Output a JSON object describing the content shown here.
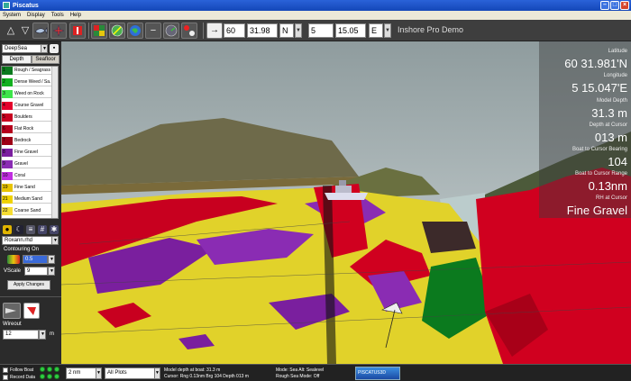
{
  "window": {
    "title": "Piscatus"
  },
  "menu": [
    "System",
    "Display",
    "Tools",
    "Help"
  ],
  "toolbar": {
    "buttons": [
      "up-triangle-icon",
      "down-triangle-icon",
      "fish-icon",
      "compass-rose-icon",
      "flag-icon",
      "color-map-icon",
      "globe-pencil-icon",
      "globe-icon",
      "minus-icon",
      "gauge-icon",
      "move-icon"
    ],
    "goto_arrow": "→",
    "lat_deg": "60",
    "lat_min": "31.98",
    "lat_hemi": "N",
    "lon_deg": "5",
    "lon_min": "15.05",
    "lon_hemi": "E",
    "mode_label": "Inshore Pro Demo"
  },
  "left_panel": {
    "map_select": "DeepSea",
    "tabs": [
      "Depth",
      "Seafloor"
    ],
    "legend": [
      {
        "num": "1",
        "label": "Rough / Seagrass",
        "color": "#0b7a1e"
      },
      {
        "num": "2",
        "label": "Dense Weed / Sa...",
        "color": "#13b020"
      },
      {
        "num": "3",
        "label": "Weed on Rock",
        "color": "#3ee54a"
      },
      {
        "num": "4",
        "label": "Course Gravel",
        "color": "#e3002a"
      },
      {
        "num": "5",
        "label": "Boulders",
        "color": "#c80020"
      },
      {
        "num": "6",
        "label": "Flat Rock",
        "color": "#b5001c"
      },
      {
        "num": "7",
        "label": "Bedrock",
        "color": "#9e0016"
      },
      {
        "num": "8",
        "label": "Fine Gravel",
        "color": "#7a1f9e"
      },
      {
        "num": "9",
        "label": "Gravel",
        "color": "#8a2cb3"
      },
      {
        "num": "10",
        "label": "Coral",
        "color": "#c02de0"
      },
      {
        "num": "19",
        "label": "Fine Sand",
        "color": "#e8c400"
      },
      {
        "num": "21",
        "label": "Medium Sand",
        "color": "#f0d200"
      },
      {
        "num": "22",
        "label": "Coarse Sand",
        "color": "#f6dd33"
      }
    ],
    "file_select": "Roxann.rhd",
    "contouring_label": "Contouring On",
    "contour_value": "0.5",
    "vscale_label": "VScale",
    "vscale_value": "9",
    "apply_label": "Apply Changes",
    "wireout_label": "Wireout",
    "wireout_value": "12",
    "wireout_unit": "m"
  },
  "info": {
    "lat_label": "Latitude",
    "lat_value": "60 31.981'N",
    "lon_label": "Longitude",
    "lon_value": "5 15.047'E",
    "depth_label": "Model Depth",
    "depth_value": "31.3 m",
    "cursor_depth_label": "Depth at Cursor",
    "cursor_depth_value": "013 m",
    "bearing_label": "Boat to Cursor Bearing",
    "bearing_value": "104",
    "range_label": "Boat to Cursor Range",
    "range_value": "0.13nm",
    "rh_label": "RH at Cursor",
    "rh_value": "Fine Gravel"
  },
  "status": {
    "follow_boat": "Follow Boat",
    "record_data": "Record Data",
    "range_select": "2 nm",
    "plots_select": "All Plots",
    "boat_line": "Model depth at boat: 31.3 m",
    "cursor_line": "Cursor: Rng 0.13nm Brg 104 Depth 013 m",
    "mode_line": "Mode: Sea  Alt: Sealevel",
    "rough_line": "Rough Sea Mode: Off",
    "logo": "PISCATUS3D"
  },
  "colors": {
    "sky_top": "#8f9c9e",
    "sky_bottom": "#d2dadb",
    "sand": "#e1d22a",
    "gravel": "#7a1f9e",
    "rock": "#d0001f",
    "weed": "#0b7a1e"
  }
}
